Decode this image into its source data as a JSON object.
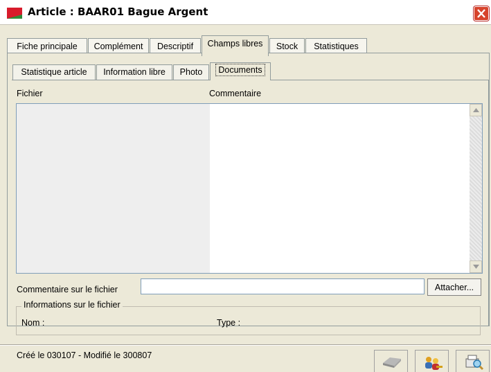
{
  "window": {
    "title": "Article : BAAR01 Bague Argent"
  },
  "main_tabs": [
    "Fiche principale",
    "Complément",
    "Descriptif",
    "Champs libres",
    "Stock",
    "Statistiques"
  ],
  "active_main_tab": "Champs libres",
  "sub_tabs": [
    "Statistique article",
    "Information libre",
    "Photo",
    "Documents"
  ],
  "active_sub_tab": "Documents",
  "list": {
    "columns": [
      "Fichier",
      "Commentaire"
    ],
    "rows": []
  },
  "comment": {
    "label": "Commentaire sur le fichier",
    "value": "",
    "attach_label": "Attacher..."
  },
  "file_info": {
    "legend": "Informations sur le fichier",
    "nom_label": "Nom :",
    "type_label": "Type :"
  },
  "status": {
    "text": "Créé le 030107 - Modifié le 300807"
  },
  "toolbar_icons": [
    "eraser-icon",
    "users-key-icon",
    "print-preview-icon"
  ],
  "colors": {
    "accent_red": "#d7432b",
    "window_bg": "#ece9d8",
    "border": "#919b9c"
  }
}
